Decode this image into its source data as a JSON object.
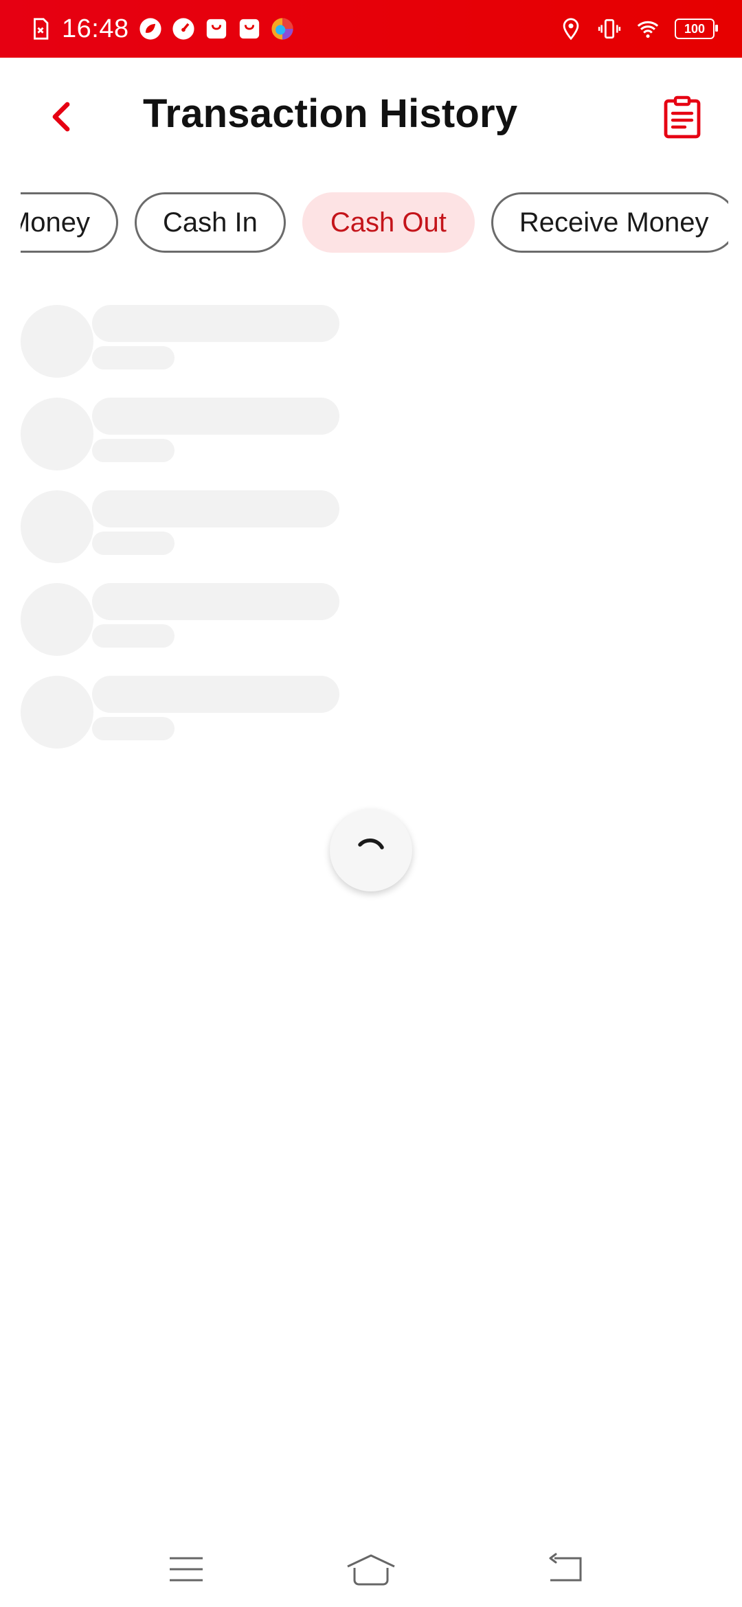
{
  "status_bar": {
    "time": "16:48",
    "battery_level": "100",
    "icons_left": [
      "sim-off-icon",
      "leaf-app-icon",
      "gauge-app-icon",
      "shopping-bag-icon",
      "shopping-bag-icon",
      "browser-app-icon"
    ],
    "icons_right": [
      "location-icon",
      "vibrate-icon",
      "wifi-icon",
      "battery-icon"
    ],
    "background_color": "#e60000"
  },
  "header": {
    "title": "Transaction History",
    "back_icon": "chevron-left-icon",
    "report_icon": "clipboard-list-icon",
    "accent_color": "#e60012"
  },
  "filters": {
    "chips": [
      {
        "label": "Send Money",
        "visible_text": "Money",
        "active": false
      },
      {
        "label": "Cash In",
        "visible_text": "Cash In",
        "active": false
      },
      {
        "label": "Cash Out",
        "visible_text": "Cash Out",
        "active": true
      },
      {
        "label": "Receive Money",
        "visible_text": "Receive Money",
        "active": false
      }
    ],
    "active_background": "#fde3e4",
    "active_text_color": "#c4141a"
  },
  "list_state": {
    "loading": true,
    "placeholder_rows": 5
  },
  "nav_bar": {
    "buttons": [
      "menu-icon",
      "home-icon",
      "back-icon"
    ]
  }
}
